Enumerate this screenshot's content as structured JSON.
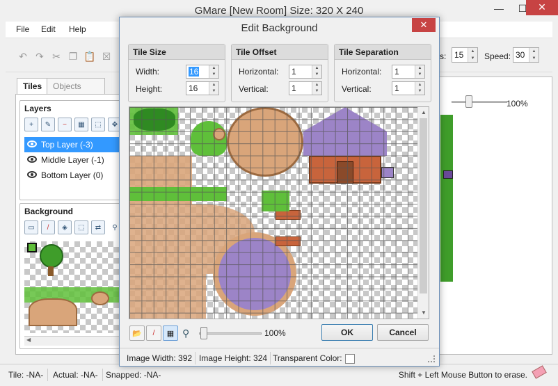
{
  "app": {
    "title": "GMare [New Room] Size: 320 X 240",
    "window_controls": {
      "minimize": "—",
      "maximize": "☐",
      "close": "✕"
    }
  },
  "menu": [
    "File",
    "Edit",
    "Help"
  ],
  "toolbar": {
    "layers_label": "rs:",
    "layers_value": "15",
    "speed_label": "Speed:",
    "speed_value": "30"
  },
  "tabs": {
    "tiles": "Tiles",
    "objects": "Objects"
  },
  "layers": {
    "title": "Layers",
    "items": [
      {
        "label": "Top Layer (-3)",
        "selected": true
      },
      {
        "label": "Middle Layer (-1)",
        "selected": false
      },
      {
        "label": "Bottom Layer (0)",
        "selected": false
      }
    ]
  },
  "background_panel": {
    "title": "Background"
  },
  "right_view": {
    "zoom": "100%"
  },
  "status": {
    "tile": "Tile: -NA-",
    "actual": "Actual: -NA-",
    "snapped": "Snapped: -NA-",
    "hint": "Shift + Left Mouse Button to erase."
  },
  "dialog": {
    "title": "Edit Background",
    "close": "✕",
    "tile_size": {
      "title": "Tile Size",
      "width_label": "Width:",
      "width": "16",
      "height_label": "Height:",
      "height": "16"
    },
    "tile_offset": {
      "title": "Tile Offset",
      "h_label": "Horizontal:",
      "h": "1",
      "v_label": "Vertical:",
      "v": "1"
    },
    "tile_separation": {
      "title": "Tile Separation",
      "h_label": "Horizontal:",
      "h": "1",
      "v_label": "Vertical:",
      "v": "1"
    },
    "zoom": "100%",
    "ok": "OK",
    "cancel": "Cancel",
    "image_width": "Image Width: 392",
    "image_height": "Image Height: 324",
    "transparent_color": "Transparent Color:"
  },
  "colors": {
    "accent": "#3399ff",
    "close_red": "#c74343",
    "grass": "#5fbf3a",
    "wood": "#d9a57a",
    "roof": "#9c84c7",
    "brick": "#c8643c"
  }
}
